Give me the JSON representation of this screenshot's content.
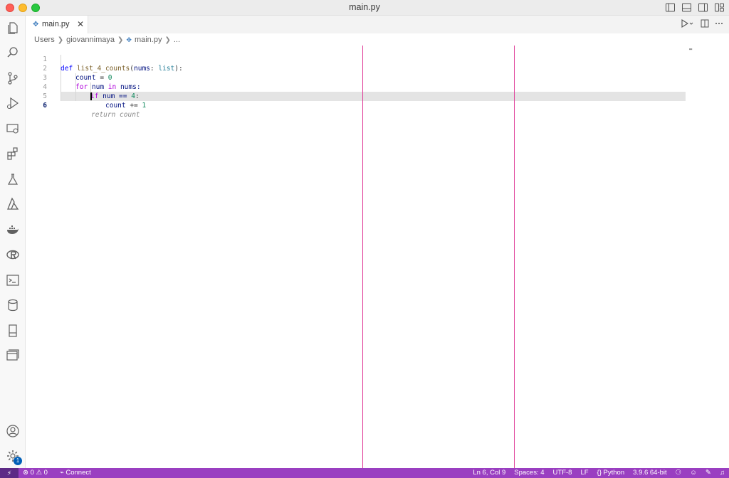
{
  "window": {
    "title": "main.py"
  },
  "tab": {
    "label": "main.py",
    "close": "✕"
  },
  "breadcrumb": {
    "items": [
      "Users",
      "giovannimaya",
      "main.py",
      "..."
    ]
  },
  "editor": {
    "line_numbers": [
      "1",
      "2",
      "3",
      "4",
      "5",
      "6"
    ],
    "lines": {
      "l1": {
        "def": "def",
        "fn": "list_4_counts",
        "open": "(",
        "param": "nums",
        "colon": ": ",
        "type": "list",
        "close": "):"
      },
      "l2": {
        "var": "count",
        "op": " = ",
        "val": "0"
      },
      "l3": {
        "for": "for",
        "var": " num ",
        "in": "in",
        "rest": " nums:"
      },
      "l4": {
        "if": "if",
        "rest": " num == ",
        "val": "4",
        "colon": ":"
      },
      "l5": {
        "var": "count",
        "op": " += ",
        "val": "1"
      },
      "l6": {
        "ghost": "return count"
      }
    }
  },
  "statusbar": {
    "remote": "⚡",
    "problems": "⊗ 0 ⚠ 0",
    "connect": "Connect",
    "position": "Ln 6, Col 9",
    "spaces": "Spaces: 4",
    "encoding": "UTF-8",
    "eol": "LF",
    "language": "Python",
    "interpreter": "3.9.6 64-bit"
  },
  "badges": {
    "settings": "1"
  }
}
